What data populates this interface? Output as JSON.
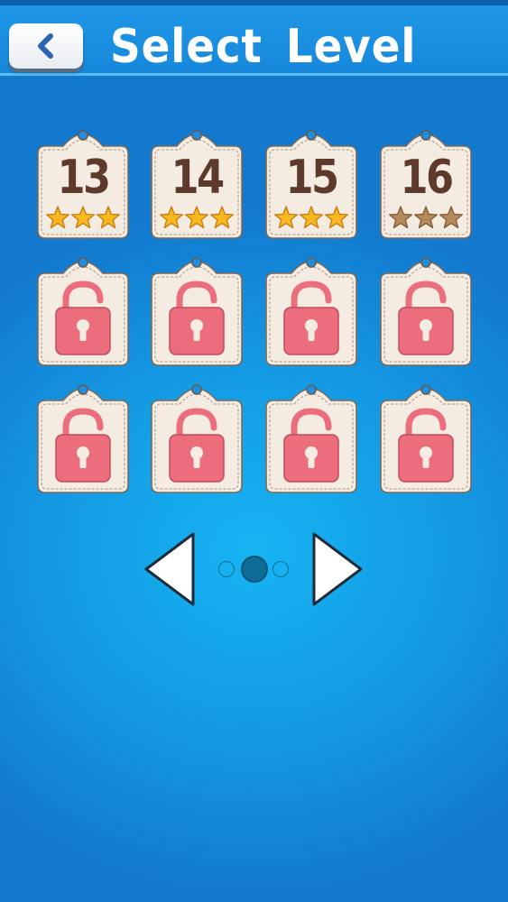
{
  "header": {
    "title": "Select Level",
    "back_icon": "chevron-left-icon"
  },
  "colors": {
    "header_bg": "#1788dc",
    "background": "#1499e3",
    "tile_bg": "#f4ece1",
    "number": "#5e3a2c",
    "star_gold": "#f8b820",
    "star_bronze": "#b68a5a",
    "lock": "#ec6e7c",
    "active_dot": "#0d6d96"
  },
  "levels": [
    {
      "number": "13",
      "locked": false,
      "stars": 3,
      "star_style": "gold"
    },
    {
      "number": "14",
      "locked": false,
      "stars": 3,
      "star_style": "gold"
    },
    {
      "number": "15",
      "locked": false,
      "stars": 3,
      "star_style": "gold"
    },
    {
      "number": "16",
      "locked": false,
      "stars": 3,
      "star_style": "bronze"
    },
    {
      "locked": true
    },
    {
      "locked": true
    },
    {
      "locked": true
    },
    {
      "locked": true
    },
    {
      "locked": true
    },
    {
      "locked": true
    },
    {
      "locked": true
    },
    {
      "locked": true
    }
  ],
  "pager": {
    "pages": 3,
    "current_page": 2,
    "prev_icon": "triangle-left-icon",
    "next_icon": "triangle-right-icon"
  }
}
